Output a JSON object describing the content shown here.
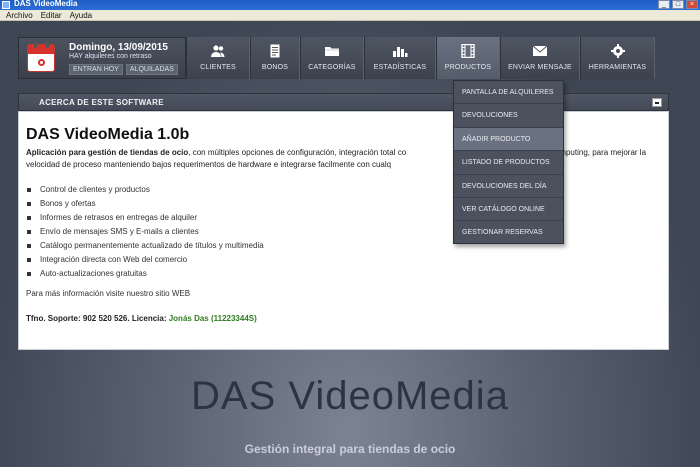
{
  "window": {
    "title": "DAS VideoMedia",
    "min": "_",
    "max": "□",
    "close": "×"
  },
  "menu": [
    "Archivo",
    "Editar",
    "Ayuda"
  ],
  "date": {
    "text": "Domingo, 13/09/2015",
    "subtitle": "HAY alquileres con retraso",
    "tab_today": "ENTRAN HOY",
    "tab_rented": "ALQUILADAS"
  },
  "nav": [
    {
      "label": "CLIENTES",
      "icon": "users-icon"
    },
    {
      "label": "BONOS",
      "icon": "document-icon"
    },
    {
      "label": "CATEGORÍAS",
      "icon": "folder-icon"
    },
    {
      "label": "ESTADÍSTICAS",
      "icon": "bar-chart-icon"
    },
    {
      "label": "PRODUCTOS",
      "icon": "film-icon"
    },
    {
      "label": "ENVIAR MENSAJE",
      "icon": "envelope-icon"
    },
    {
      "label": "HERRAMIENTAS",
      "icon": "gear-icon"
    }
  ],
  "dropdown": [
    "PANTALLA DE ALQUILERES",
    "DEVOLUCIONES",
    "AÑADIR PRODUCTO",
    "LISTADO DE PRODUCTOS",
    "DEVOLUCIONES DEL DÍA",
    "VER CATÁLOGO ONLINE",
    "GESTIONAR RESERVAS"
  ],
  "panel": {
    "header": "ACERCA DE ESTE SOFTWARE",
    "title": "DAS VideoMedia 1.0b",
    "intro_bold": "Aplicación para gestión de tiendas de ocio",
    "intro_rest": ", con múltiples opciones de configuración, integración total co",
    "intro_tail": "gía cloud computing, para mejorar la velocidad de proceso manteniendo bajos requerimentos de hardware e integrarse facilmente con cualq",
    "features": [
      "Control de clientes y productos",
      "Bonos y ofertas",
      "Informes de retrasos en entregas de alquiler",
      "Envío de mensajes SMS y E-mails a clientes",
      "Catálogo permanentemente actualizado de títulos y multimedia",
      "Integración directa con Web del comercio",
      "Auto-actualizaciones gratuitas"
    ],
    "more_info": "Para más información visite nuestro sitio WEB",
    "support_label": "Tfno. Soporte: 902 520 526. Licencia: ",
    "license": "Jonás Das (11223344S)"
  },
  "brand": "DAS VideoMedia",
  "tagline": "Gestión integral para tiendas de ocio"
}
